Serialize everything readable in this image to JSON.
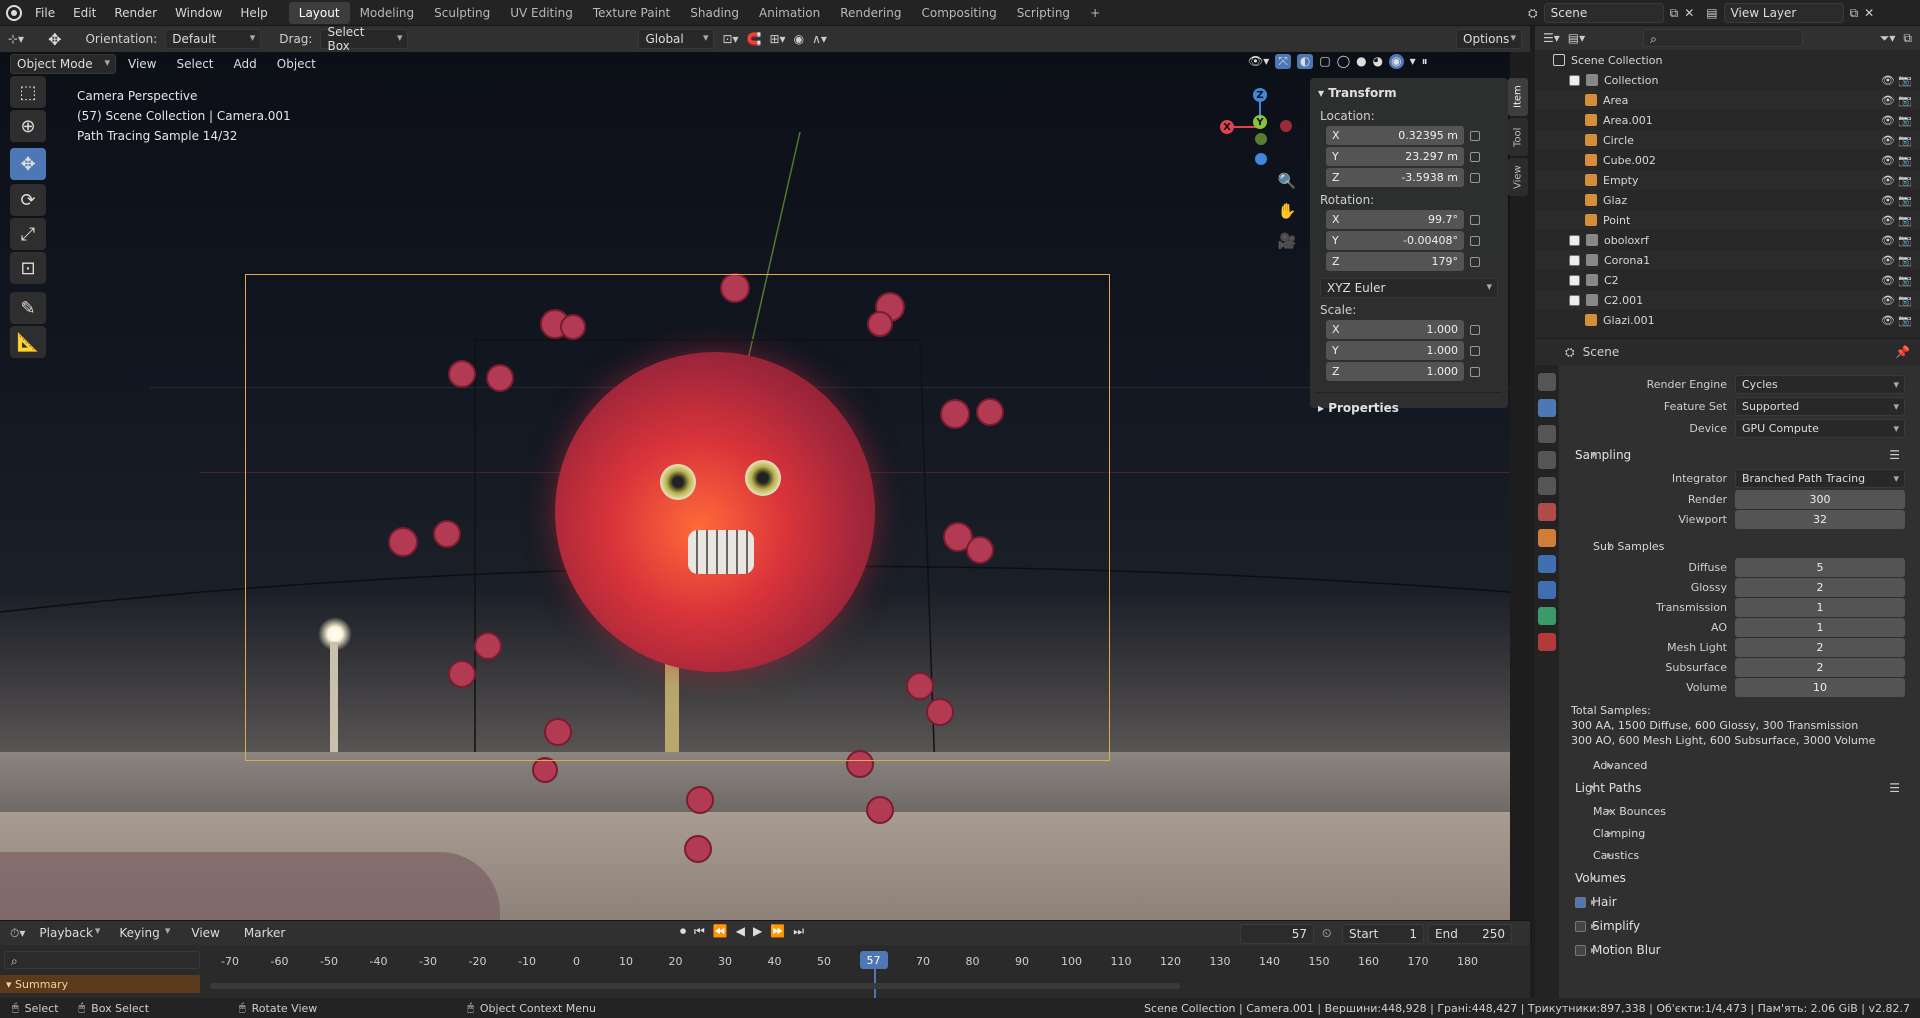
{
  "topbar": {
    "menus": [
      "File",
      "Edit",
      "Render",
      "Window",
      "Help"
    ],
    "workspaces": [
      "Layout",
      "Modeling",
      "Sculpting",
      "UV Editing",
      "Texture Paint",
      "Shading",
      "Animation",
      "Rendering",
      "Compositing",
      "Scripting"
    ],
    "active_workspace": "Layout",
    "add_tab": "+",
    "scene": "Scene",
    "view_layer": "View Layer"
  },
  "header": {
    "orientation_label": "Orientation:",
    "orientation_value": "Default",
    "drag_label": "Drag:",
    "drag_value": "Select Box",
    "transform_space": "Global",
    "options": "Options"
  },
  "viewport_header": {
    "mode": "Object Mode",
    "menus": [
      "View",
      "Select",
      "Add",
      "Object"
    ]
  },
  "viewport_info": {
    "line1": "Camera Perspective",
    "line2": "(57) Scene Collection | Camera.001",
    "line3": "Path Tracing Sample 14/32"
  },
  "npanel": {
    "title": "Transform",
    "location_label": "Location:",
    "location": [
      {
        "axis": "X",
        "value": "0.32395 m"
      },
      {
        "axis": "Y",
        "value": "23.297 m"
      },
      {
        "axis": "Z",
        "value": "-3.5938 m"
      }
    ],
    "rotation_label": "Rotation:",
    "rotation": [
      {
        "axis": "X",
        "value": "99.7°"
      },
      {
        "axis": "Y",
        "value": "-0.00408°"
      },
      {
        "axis": "Z",
        "value": "179°"
      }
    ],
    "rotation_mode": "XYZ Euler",
    "scale_label": "Scale:",
    "scale": [
      {
        "axis": "X",
        "value": "1.000"
      },
      {
        "axis": "Y",
        "value": "1.000"
      },
      {
        "axis": "Z",
        "value": "1.000"
      }
    ],
    "properties": "Properties",
    "tabs": [
      "Item",
      "Tool",
      "View"
    ]
  },
  "outliner": {
    "root": "Scene Collection",
    "items": [
      {
        "name": "Collection",
        "indent": 1
      },
      {
        "name": "Area",
        "indent": 2
      },
      {
        "name": "Area.001",
        "indent": 2
      },
      {
        "name": "Circle",
        "indent": 2
      },
      {
        "name": "Cube.002",
        "indent": 2
      },
      {
        "name": "Empty",
        "indent": 2
      },
      {
        "name": "Glaz",
        "indent": 2
      },
      {
        "name": "Point",
        "indent": 2
      },
      {
        "name": "oboloxrf",
        "indent": 1
      },
      {
        "name": "Corona1",
        "indent": 1
      },
      {
        "name": "C2",
        "indent": 1
      },
      {
        "name": "C2.001",
        "indent": 1
      },
      {
        "name": "Glazi.001",
        "indent": 2
      }
    ]
  },
  "properties": {
    "context": "Scene",
    "render_engine_label": "Render Engine",
    "render_engine": "Cycles",
    "feature_set_label": "Feature Set",
    "feature_set": "Supported",
    "device_label": "Device",
    "device": "GPU Compute",
    "sampling": "Sampling",
    "integrator_label": "Integrator",
    "integrator": "Branched Path Tracing",
    "render_label": "Render",
    "render_samples": "300",
    "viewport_label": "Viewport",
    "viewport_samples": "32",
    "sub_samples": "Sub Samples",
    "subs": [
      {
        "label": "Diffuse",
        "value": "5"
      },
      {
        "label": "Glossy",
        "value": "2"
      },
      {
        "label": "Transmission",
        "value": "1"
      },
      {
        "label": "AO",
        "value": "1"
      },
      {
        "label": "Mesh Light",
        "value": "2"
      },
      {
        "label": "Subsurface",
        "value": "2"
      },
      {
        "label": "Volume",
        "value": "10"
      }
    ],
    "total_label": "Total Samples:",
    "total_line1": "300 AA, 1500 Diffuse, 600 Glossy, 300 Transmission",
    "total_line2": "300 AO, 600 Mesh Light, 600 Subsurface, 3000 Volume",
    "advanced": "Advanced",
    "light_paths": "Light Paths",
    "max_bounces": "Max Bounces",
    "clamping": "Clamping",
    "caustics": "Caustics",
    "volumes": "Volumes",
    "hair": "Hair",
    "simplify": "Simplify",
    "motion_blur": "Motion Blur"
  },
  "timeline": {
    "menus": [
      "Playback",
      "Keying",
      "View",
      "Marker"
    ],
    "current_frame": "57",
    "start_label": "Start",
    "start": "1",
    "end_label": "End",
    "end": "250",
    "summary": "Summary",
    "ticks": [
      "-70",
      "-60",
      "-50",
      "-40",
      "-30",
      "-20",
      "-10",
      "0",
      "10",
      "20",
      "30",
      "40",
      "50",
      "57",
      "70",
      "80",
      "90",
      "100",
      "110",
      "120",
      "130",
      "140",
      "150",
      "160",
      "170",
      "180"
    ]
  },
  "statusbar": {
    "select": "Select",
    "box_select": "Box Select",
    "rotate_view": "Rotate View",
    "context_menu": "Object Context Menu",
    "stats": "Scene Collection | Camera.001 | Вершини:448,928 | Грані:448,427 | Трикутники:897,338 | Об'єкти:1/4,473 | Пам'ять: 2.06 GiB | v2.82.7"
  },
  "colors": {
    "accent": "#4d77b5",
    "camera_frame": "#e3a84a",
    "axis_x": "#e0424f",
    "axis_y": "#88c33b",
    "axis_z": "#3f88dd"
  }
}
